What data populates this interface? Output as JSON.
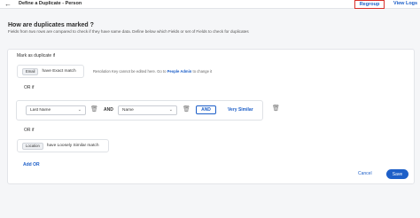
{
  "header": {
    "back_glyph": "←",
    "title": "Define a Duplicate - Person",
    "regroup_label": "Regroup",
    "view_logs_label": "View Logs"
  },
  "main": {
    "heading": "How are duplicates marked ?",
    "description": "Fields from two rows are compared to check if they have same data. Define below which Fields or set of Fields to check for duplicates"
  },
  "rules": {
    "section_label": "Mark as duplicate if",
    "rule1": {
      "field_tag": "Email",
      "match": "have Exact match"
    },
    "note": {
      "text": "Resolution Key cannot be edited here. Go to",
      "link": "People Admin",
      "suffix": "to change it"
    },
    "or1": "OR if",
    "rule2": {
      "field1": "Last Name",
      "and_text": "AND",
      "field2": "Name",
      "and_button": "AND",
      "match_type": "Very Similar"
    },
    "or2": "OR if",
    "rule3": {
      "field_tag": "Location",
      "match": "have Loosely Similar match"
    },
    "add_or_label": "Add OR"
  },
  "footer": {
    "cancel_label": "Cancel",
    "save_label": "Save"
  },
  "icons": {
    "back": "back-arrow-icon",
    "trash": "trash-icon",
    "chevron": "chevron-down-icon"
  },
  "colors": {
    "accent": "#1d5fc8",
    "highlight_border": "#d9312b"
  }
}
